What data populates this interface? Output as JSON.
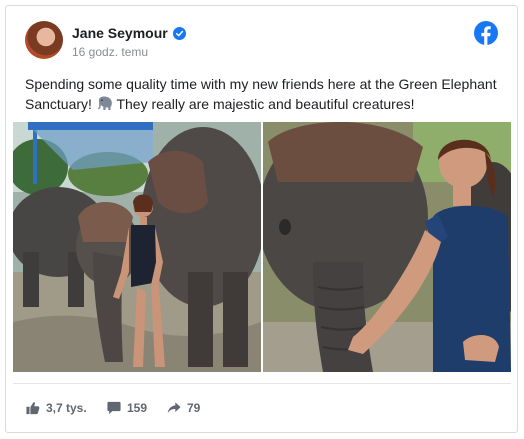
{
  "post": {
    "author": "Jane Seymour",
    "timestamp": "16 godz. temu",
    "text": "Spending some quality time with my new friends here at the Green Elephant Sanctuary!",
    "text_after_emoji": "They really are majestic and beautiful creatures!",
    "emoji_icon": "elephant-emoji"
  },
  "stats": {
    "likes": "3,7 tys.",
    "comments": "159",
    "shares": "79"
  },
  "colors": {
    "facebook_blue": "#1877f2",
    "verified_blue": "#1877f2",
    "action_gray": "#606770"
  },
  "icons": {
    "verified": "verified-badge-icon",
    "logo": "facebook-logo-icon",
    "like": "thumbs-up-icon",
    "comment": "comment-icon",
    "share": "share-arrow-icon"
  }
}
